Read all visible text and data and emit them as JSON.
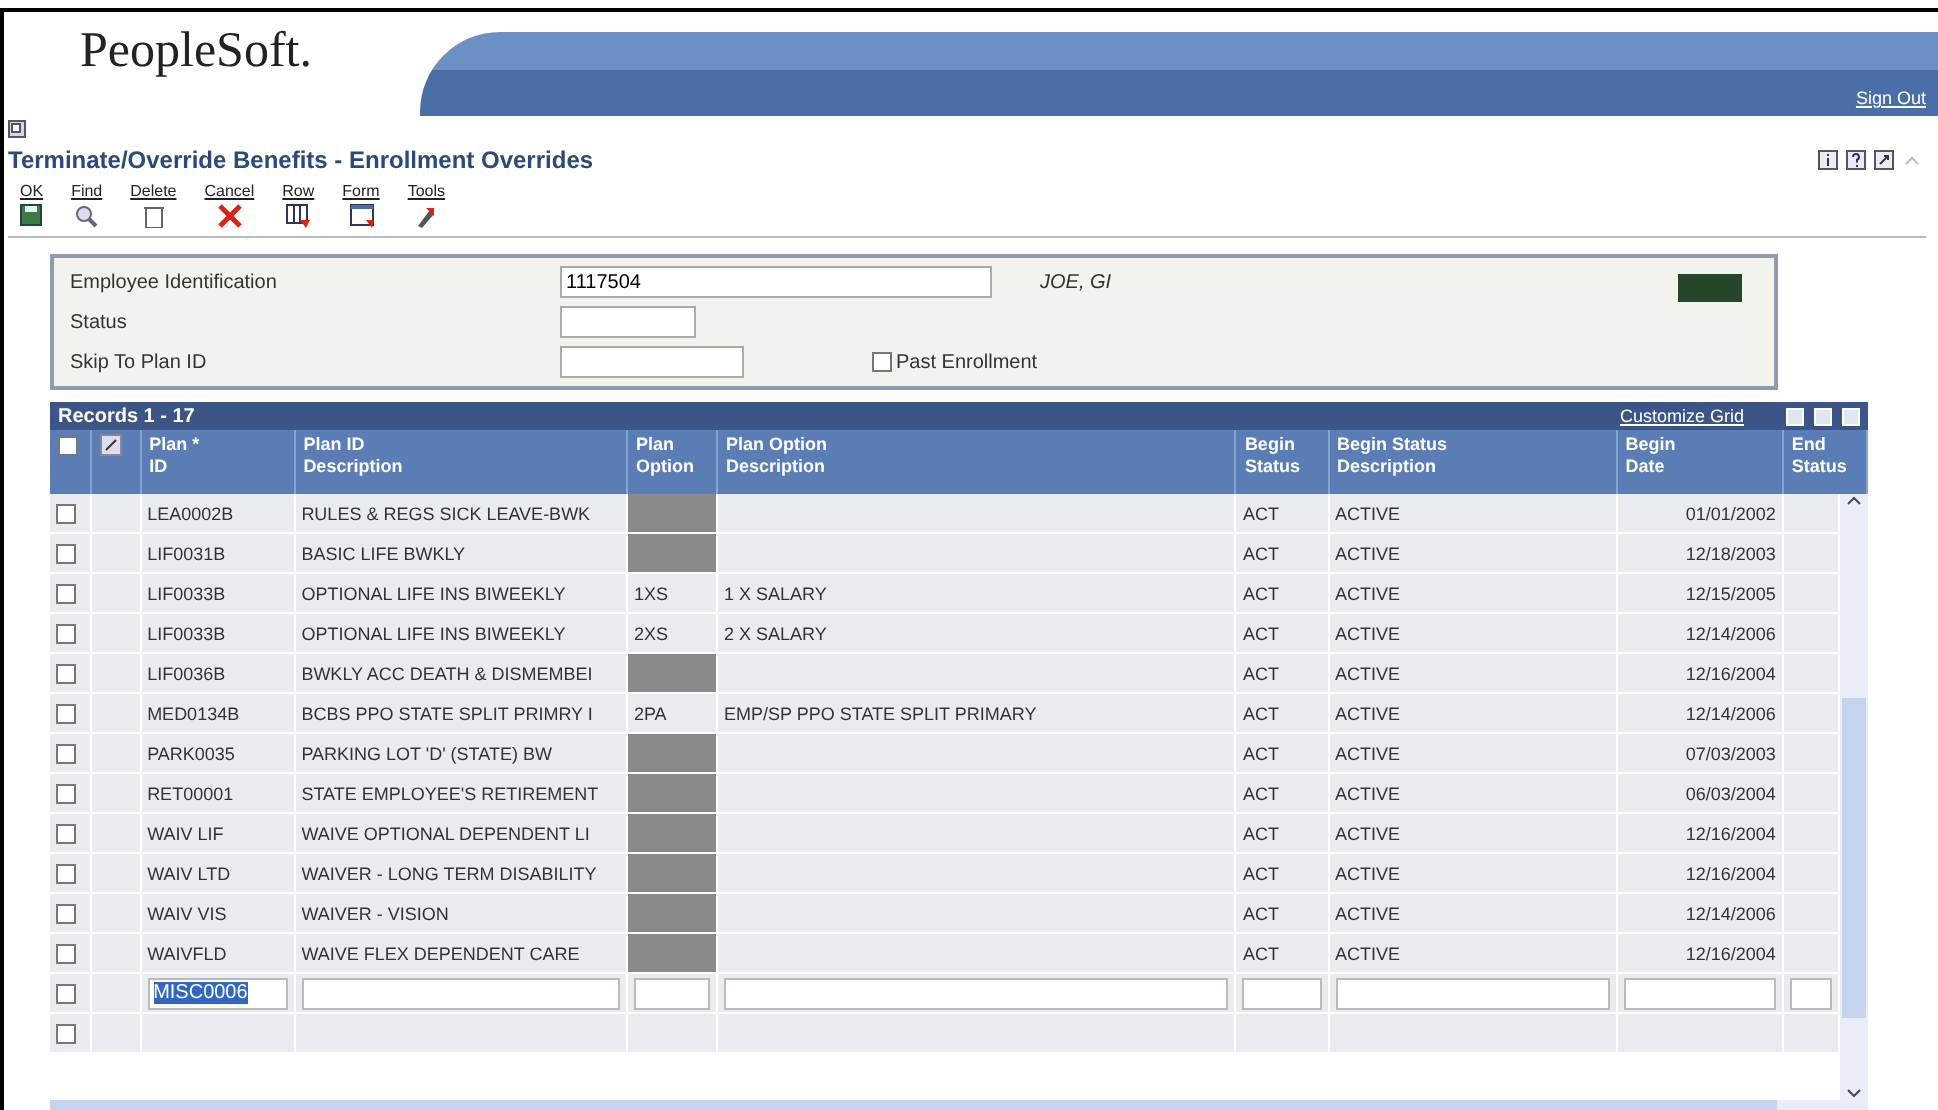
{
  "header": {
    "logo": "PeopleSoft.",
    "sign_out": "Sign Out"
  },
  "form_title": "Terminate/Override Benefits - Enrollment Overrides",
  "toolbar": [
    {
      "label": "OK",
      "kind": "save"
    },
    {
      "label": "Find",
      "kind": "find"
    },
    {
      "label": "Delete",
      "kind": "delete"
    },
    {
      "label": "Cancel",
      "kind": "cancel"
    },
    {
      "label": "Row",
      "kind": "row"
    },
    {
      "label": "Form",
      "kind": "form"
    },
    {
      "label": "Tools",
      "kind": "tools"
    }
  ],
  "fields": {
    "employee_id": {
      "label": "Employee Identification",
      "value": "1117504",
      "name": "JOE, GI"
    },
    "status": {
      "label": "Status"
    },
    "skip_to_plan": {
      "label": "Skip To Plan ID"
    },
    "past_enrollment": {
      "label": "Past Enrollment",
      "checked": false
    }
  },
  "grid": {
    "title": "Records 1 - 17",
    "customize_link": "Customize Grid",
    "select_all_checked": false,
    "blank_row_checked": false,
    "columns": [
      [
        "Plan *",
        "ID"
      ],
      [
        "Plan ID",
        "Description"
      ],
      [
        "Plan",
        "Option"
      ],
      [
        "Plan Option",
        "Description"
      ],
      [
        "Begin",
        "Status"
      ],
      [
        "Begin Status",
        "Description"
      ],
      [
        "Begin",
        "Date"
      ],
      [
        "End",
        "Status"
      ]
    ],
    "rows": [
      {
        "checked": false,
        "plan_id": "LEA0002B",
        "description": "RULES & REGS SICK LEAVE-BWK",
        "option_locked": true,
        "begin_status": "ACT",
        "status_description": "ACTIVE",
        "begin_date": "01/01/2002"
      },
      {
        "checked": false,
        "plan_id": "LIF0031B",
        "description": "BASIC LIFE BWKLY",
        "option_locked": true,
        "begin_status": "ACT",
        "status_description": "ACTIVE",
        "begin_date": "12/18/2003"
      },
      {
        "checked": false,
        "plan_id": "LIF0033B",
        "description": "OPTIONAL LIFE INS BIWEEKLY",
        "option_locked": false,
        "plan_option": "1XS",
        "option_description": "1 X SALARY",
        "begin_status": "ACT",
        "status_description": "ACTIVE",
        "begin_date": "12/15/2005"
      },
      {
        "checked": false,
        "plan_id": "LIF0033B",
        "description": "OPTIONAL LIFE INS BIWEEKLY",
        "option_locked": false,
        "plan_option": "2XS",
        "option_description": "2 X SALARY",
        "begin_status": "ACT",
        "status_description": "ACTIVE",
        "begin_date": "12/14/2006"
      },
      {
        "checked": false,
        "plan_id": "LIF0036B",
        "description": "BWKLY ACC DEATH & DISMEMBEI",
        "option_locked": true,
        "begin_status": "ACT",
        "status_description": "ACTIVE",
        "begin_date": "12/16/2004"
      },
      {
        "checked": false,
        "plan_id": "MED0134B",
        "description": "BCBS PPO STATE SPLIT PRIMRY I",
        "option_locked": false,
        "plan_option": "2PA",
        "option_description": "EMP/SP PPO STATE SPLIT PRIMARY",
        "begin_status": "ACT",
        "status_description": "ACTIVE",
        "begin_date": "12/14/2006"
      },
      {
        "checked": false,
        "plan_id": "PARK0035",
        "description": "PARKING LOT 'D' (STATE) BW",
        "option_locked": true,
        "begin_status": "ACT",
        "status_description": "ACTIVE",
        "begin_date": "07/03/2003"
      },
      {
        "checked": false,
        "plan_id": "RET00001",
        "description": "STATE EMPLOYEE'S RETIREMENT",
        "option_locked": true,
        "begin_status": "ACT",
        "status_description": "ACTIVE",
        "begin_date": "06/03/2004"
      },
      {
        "checked": false,
        "plan_id": "WAIV LIF",
        "description": "WAIVE OPTIONAL DEPENDENT LI",
        "option_locked": true,
        "begin_status": "ACT",
        "status_description": "ACTIVE",
        "begin_date": "12/16/2004"
      },
      {
        "checked": false,
        "plan_id": "WAIV LTD",
        "description": "WAIVER - LONG TERM DISABILITY",
        "option_locked": true,
        "begin_status": "ACT",
        "status_description": "ACTIVE",
        "begin_date": "12/16/2004"
      },
      {
        "checked": false,
        "plan_id": "WAIV VIS",
        "description": "WAIVER - VISION",
        "option_locked": true,
        "begin_status": "ACT",
        "status_description": "ACTIVE",
        "begin_date": "12/14/2006"
      },
      {
        "checked": false,
        "plan_id": "WAIVFLD",
        "description": "WAIVE FLEX DEPENDENT CARE",
        "option_locked": true,
        "begin_status": "ACT",
        "status_description": "ACTIVE",
        "begin_date": "12/16/2004"
      }
    ],
    "new_row": {
      "checked": false,
      "plan_id": "MISC0006"
    }
  }
}
